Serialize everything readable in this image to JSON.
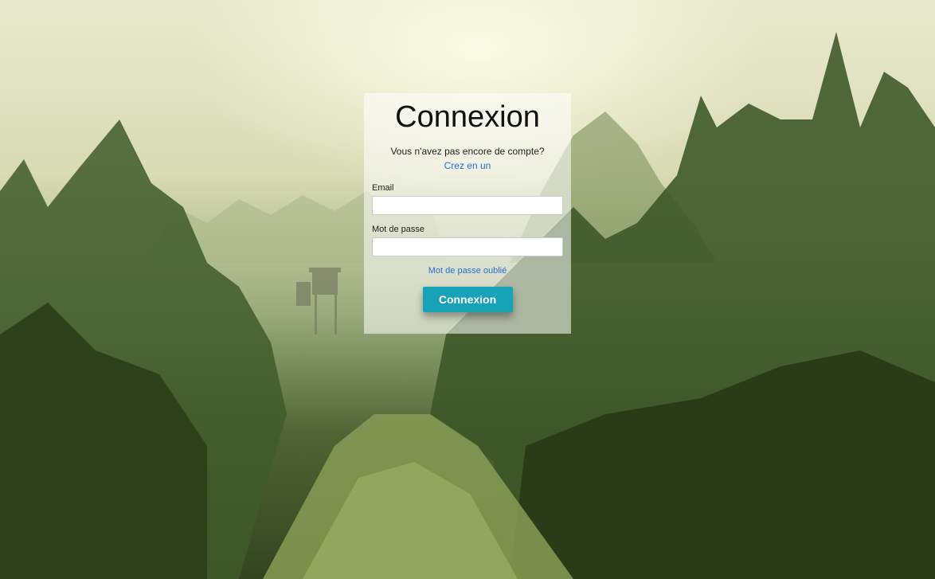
{
  "login": {
    "title": "Connexion",
    "subtitle": "Vous n'avez pas encore de compte?",
    "signup_link": "Crez en un",
    "email_label": "Email",
    "email_value": "",
    "password_label": "Mot de passe",
    "password_value": "",
    "forgot_link": "Mot de passe oublié",
    "submit_label": "Connexion"
  },
  "colors": {
    "accent": "#17a2b8",
    "link": "#2271d6"
  }
}
